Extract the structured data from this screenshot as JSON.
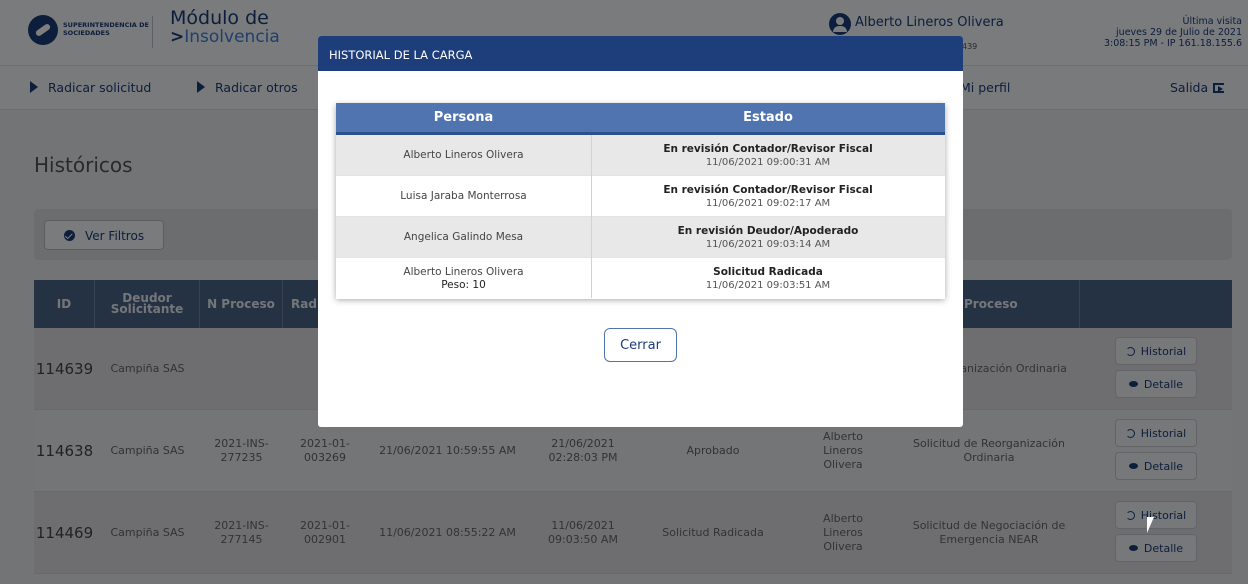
{
  "header": {
    "logo_text": "SUPERINTENDENCIA DE SOCIEDADES",
    "module_title": "Módulo de",
    "module_subtitle": "Insolvencia",
    "user_name": "Alberto Lineros Olivera",
    "user_sub": "439",
    "last_visit_label": "Última visita",
    "last_visit_date": "jueves 29 de Julio de 2021",
    "last_visit_time_ip": "3:08:15 PM - IP 161.18.155.6"
  },
  "nav": {
    "items": [
      "Radicar solicitud",
      "Radicar otros",
      "Mi perfil"
    ],
    "logout": "Salida"
  },
  "page": {
    "title": "Históricos",
    "filter_button": "Ver Filtros"
  },
  "table": {
    "headers": [
      "ID",
      "Deudor Solicitante",
      "N Proceso",
      "Rad",
      "",
      "",
      "",
      "",
      "Proceso",
      ""
    ],
    "rows": [
      {
        "id": "114639",
        "deudor": "Campiña SAS",
        "n_proceso": "",
        "radicado": "",
        "fecha_creacion": "",
        "fecha_radicacion": "",
        "estado": "",
        "persona": "",
        "proceso": "de Reorganización Ordinaria"
      },
      {
        "id": "114638",
        "deudor": "Campiña SAS",
        "n_proceso": "2021-INS-277235",
        "radicado": "2021-01-003269",
        "fecha_creacion": "21/06/2021 10:59:55 AM",
        "fecha_radicacion": "21/06/2021 02:28:03 PM",
        "estado": "Aprobado",
        "persona": "Alberto Lineros Olivera",
        "proceso": "Solicitud de Reorganización Ordinaria"
      },
      {
        "id": "114469",
        "deudor": "Campiña SAS",
        "n_proceso": "2021-INS-277145",
        "radicado": "2021-01-002901",
        "fecha_creacion": "11/06/2021 08:55:22 AM",
        "fecha_radicacion": "11/06/2021 09:03:50 AM",
        "estado": "Solicitud Radicada",
        "persona": "Alberto Lineros Olivera",
        "proceso": "Solicitud de Negociación de Emergencia NEAR"
      }
    ],
    "historial_label": "Historial",
    "detalle_label": "Detalle"
  },
  "modal": {
    "title": "HISTORIAL DE LA CARGA",
    "col_persona": "Persona",
    "col_estado": "Estado",
    "rows": [
      {
        "persona": "Alberto Lineros Olivera",
        "peso": "",
        "estado": "En revisión Contador/Revisor Fiscal",
        "fecha": "11/06/2021 09:00:31 AM"
      },
      {
        "persona": "Luisa Jaraba Monterrosa",
        "peso": "",
        "estado": "En revisión Contador/Revisor Fiscal",
        "fecha": "11/06/2021 09:02:17 AM"
      },
      {
        "persona": "Angelica Galindo Mesa",
        "peso": "",
        "estado": "En revisión Deudor/Apoderado",
        "fecha": "11/06/2021 09:03:14 AM"
      },
      {
        "persona": "Alberto Lineros Olivera",
        "peso": "Peso: 10",
        "estado": "Solicitud Radicada",
        "fecha": "11/06/2021 09:03:51 AM"
      }
    ],
    "close_button": "Cerrar"
  },
  "colors": {
    "brand_navy": "#1e3d7b",
    "table_header": "#4a6588",
    "modal_table_header": "#4f74b0"
  }
}
